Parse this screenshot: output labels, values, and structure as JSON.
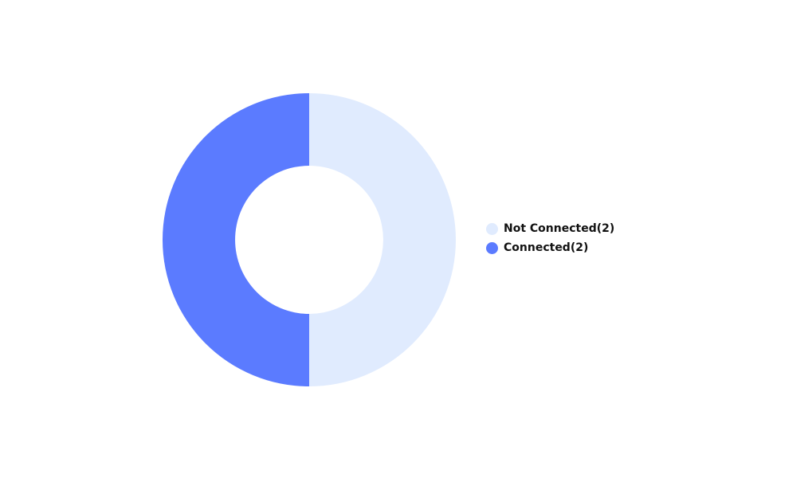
{
  "chart_data": {
    "type": "pie",
    "title": "",
    "donut": true,
    "legend_position": "right",
    "slices": [
      {
        "label": "Not Connected(2)",
        "name": "Not Connected",
        "value": 2,
        "color": "#e0ebfe"
      },
      {
        "label": "Connected(2)",
        "name": "Connected",
        "value": 2,
        "color": "#5b7bff"
      }
    ]
  }
}
